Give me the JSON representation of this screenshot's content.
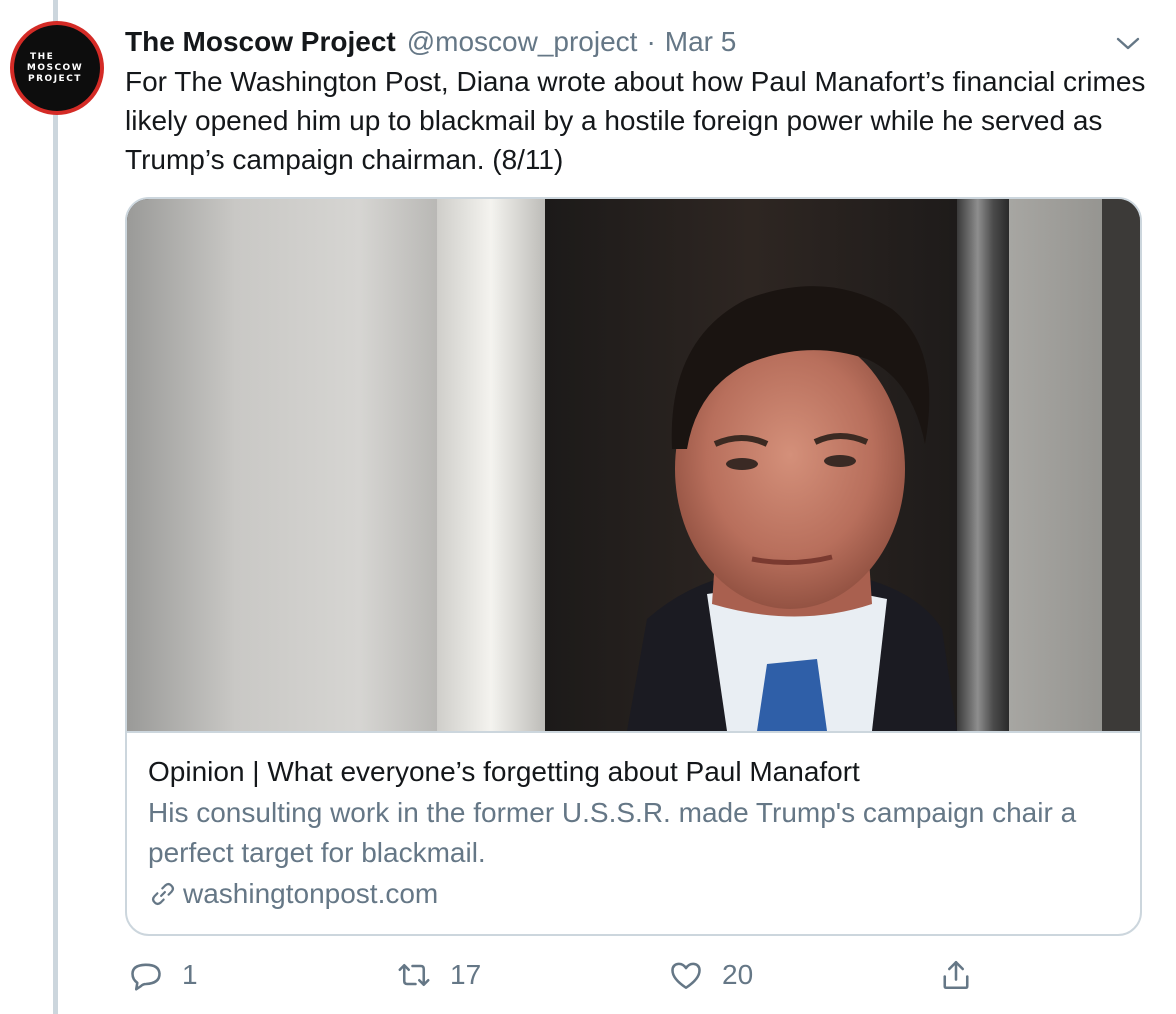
{
  "avatar": {
    "logo_lines": [
      "THE",
      "MOSCOW",
      "PROJECT"
    ],
    "ring_color": "#d42b26"
  },
  "tweet": {
    "author_name": "The Moscow Project",
    "handle": "@moscow_project",
    "separator": "·",
    "date": "Mar 5",
    "text": "For The Washington Post, Diana wrote about how Paul Manafort’s financial crimes likely opened him up to blackmail by a hostile foreign power while he served as Trump’s campaign chairman. (8/11)"
  },
  "card": {
    "title": "Opinion | What everyone’s forgetting about Paul Manafort",
    "description": "His consulting work in the former U.S.S.R. made Trump's campaign chair a perfect target for blackmail.",
    "domain": "washingtonpost.com"
  },
  "actions": {
    "reply_count": "1",
    "retweet_count": "17",
    "like_count": "20"
  },
  "icons": {
    "menu": "chevron-down-icon",
    "reply": "reply-icon",
    "retweet": "retweet-icon",
    "like": "heart-icon",
    "share": "share-icon",
    "link": "link-icon"
  },
  "colors": {
    "text": "#14171a",
    "muted": "#657786",
    "border": "#ccd6dd"
  }
}
